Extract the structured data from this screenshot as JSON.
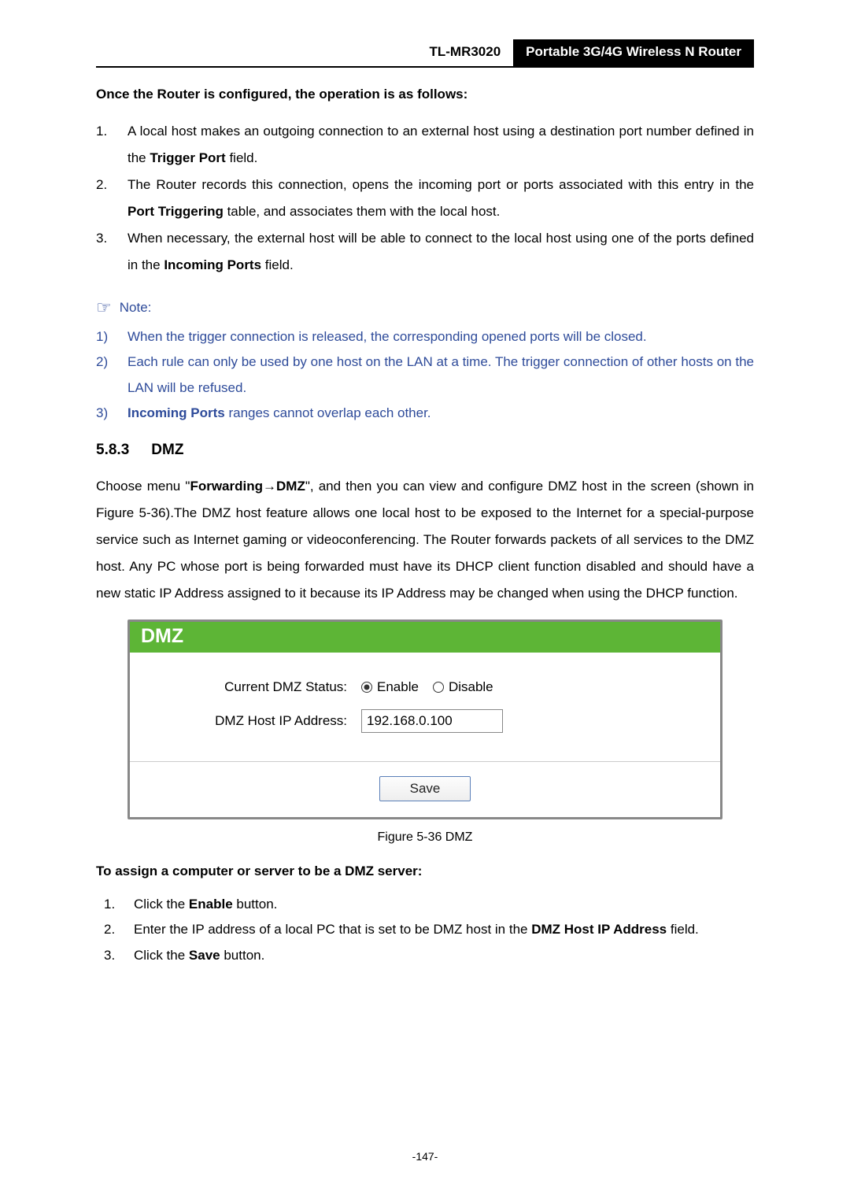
{
  "header": {
    "model": "TL-MR3020",
    "title": "Portable 3G/4G Wireless N Router"
  },
  "intro": "Once the Router is configured, the operation is as follows:",
  "steps": [
    {
      "num": "1.",
      "pre": "A local host makes an outgoing connection to an external host using a destination port number defined in the ",
      "bold": "Trigger Port",
      "post": " field."
    },
    {
      "num": "2.",
      "pre": "The Router records this connection, opens the incoming port or ports associated with this entry in the ",
      "bold": "Port Triggering",
      "post": " table, and associates them with the local host."
    },
    {
      "num": "3.",
      "pre": "When necessary, the external host will be able to connect to the local host using one of the ports defined in the ",
      "bold": "Incoming Ports",
      "post": " field."
    }
  ],
  "note_label": "Note:",
  "notes": [
    {
      "num": "1)",
      "text": "When the trigger connection is released, the corresponding opened ports will be closed."
    },
    {
      "num": "2)",
      "text": "Each rule can only be used by one host on the LAN at a time. The trigger connection of other hosts on the LAN will be refused."
    },
    {
      "num": "3)",
      "bold": "Incoming Ports",
      "text": " ranges cannot overlap each other."
    }
  ],
  "section": {
    "num": "5.8.3",
    "title": "DMZ"
  },
  "paragraph": {
    "p1": "Choose menu \"",
    "b1": "Forwarding",
    "arrow": "→",
    "b2": "DMZ",
    "p2": "\", and then you can view and configure DMZ host in the screen (shown in Figure 5-36).The DMZ host feature allows one local host to be exposed to the Internet for a special-purpose service such as Internet gaming or videoconferencing. The Router forwards packets of all services to the DMZ host. Any PC whose port is being forwarded must have its DHCP client function disabled and should have a new static IP Address assigned to it because its IP Address may be changed when using the DHCP function."
  },
  "dmz": {
    "panel_title": "DMZ",
    "status_label": "Current DMZ Status:",
    "enable": "Enable",
    "disable": "Disable",
    "ip_label": "DMZ Host IP Address:",
    "ip_value": "192.168.0.100",
    "save": "Save"
  },
  "figure_caption": "Figure 5-36   DMZ",
  "assign_heading": "To assign a computer or server to be a DMZ server:",
  "assign": [
    {
      "num": "1.",
      "pre": "Click the ",
      "bold": "Enable",
      "post": " button."
    },
    {
      "num": "2.",
      "pre": "Enter the IP address of a local PC that is set to be DMZ host in the ",
      "bold": "DMZ Host IP Address",
      "post": " field."
    },
    {
      "num": "3.",
      "pre": "Click the ",
      "bold": "Save",
      "post": " button."
    }
  ],
  "page_num": "-147-"
}
